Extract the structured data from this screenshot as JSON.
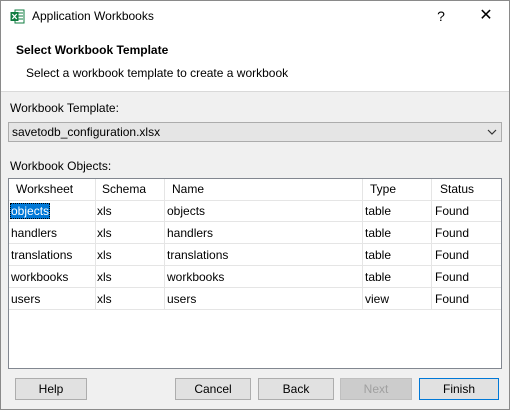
{
  "window": {
    "title": "Application Workbooks",
    "help_glyph": "?",
    "close_glyph": "✕",
    "app_icon": "excel-icon"
  },
  "header": {
    "title": "Select Workbook Template",
    "subtitle": "Select a workbook template to create a workbook"
  },
  "template": {
    "label": "Workbook Template:",
    "selected": "savetodb_configuration.xlsx"
  },
  "objects": {
    "label": "Workbook Objects:",
    "columns": [
      "Worksheet",
      "Schema",
      "Name",
      "Type",
      "Status"
    ],
    "rows": [
      [
        "objects",
        "xls",
        "objects",
        "table",
        "Found"
      ],
      [
        "handlers",
        "xls",
        "handlers",
        "table",
        "Found"
      ],
      [
        "translations",
        "xls",
        "translations",
        "table",
        "Found"
      ],
      [
        "workbooks",
        "xls",
        "workbooks",
        "table",
        "Found"
      ],
      [
        "users",
        "xls",
        "users",
        "view",
        "Found"
      ]
    ],
    "selected_row": 0
  },
  "buttons": {
    "help": "Help",
    "cancel": "Cancel",
    "back": "Back",
    "next": "Next",
    "finish": "Finish"
  }
}
